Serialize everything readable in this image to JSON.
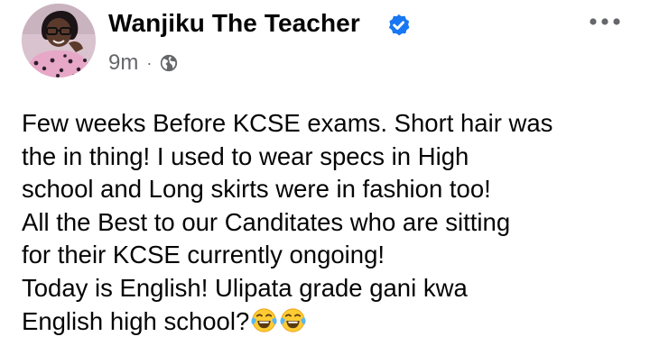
{
  "post": {
    "author": "Wanjiku The Teacher",
    "verified_icon": "verified-badge-icon",
    "timestamp": "9m",
    "separator": "·",
    "audience_icon": "globe-icon",
    "more_icon": "more-options-icon",
    "text_lines": [
      "Few weeks Before KCSE exams. Short hair was",
      "the in thing! I used to wear specs in High",
      "school and Long skirts were in fashion too!",
      "All the Best to our Canditates who are sitting",
      "for their KCSE currently ongoing!",
      "Today is English! Ulipata grade gani kwa",
      "English high school?"
    ],
    "emoji_icon": "face-with-tears-of-joy-emoji",
    "colors": {
      "verified_badge": "#1877f2",
      "secondary_text": "#65676b",
      "primary_text": "#050505"
    }
  }
}
